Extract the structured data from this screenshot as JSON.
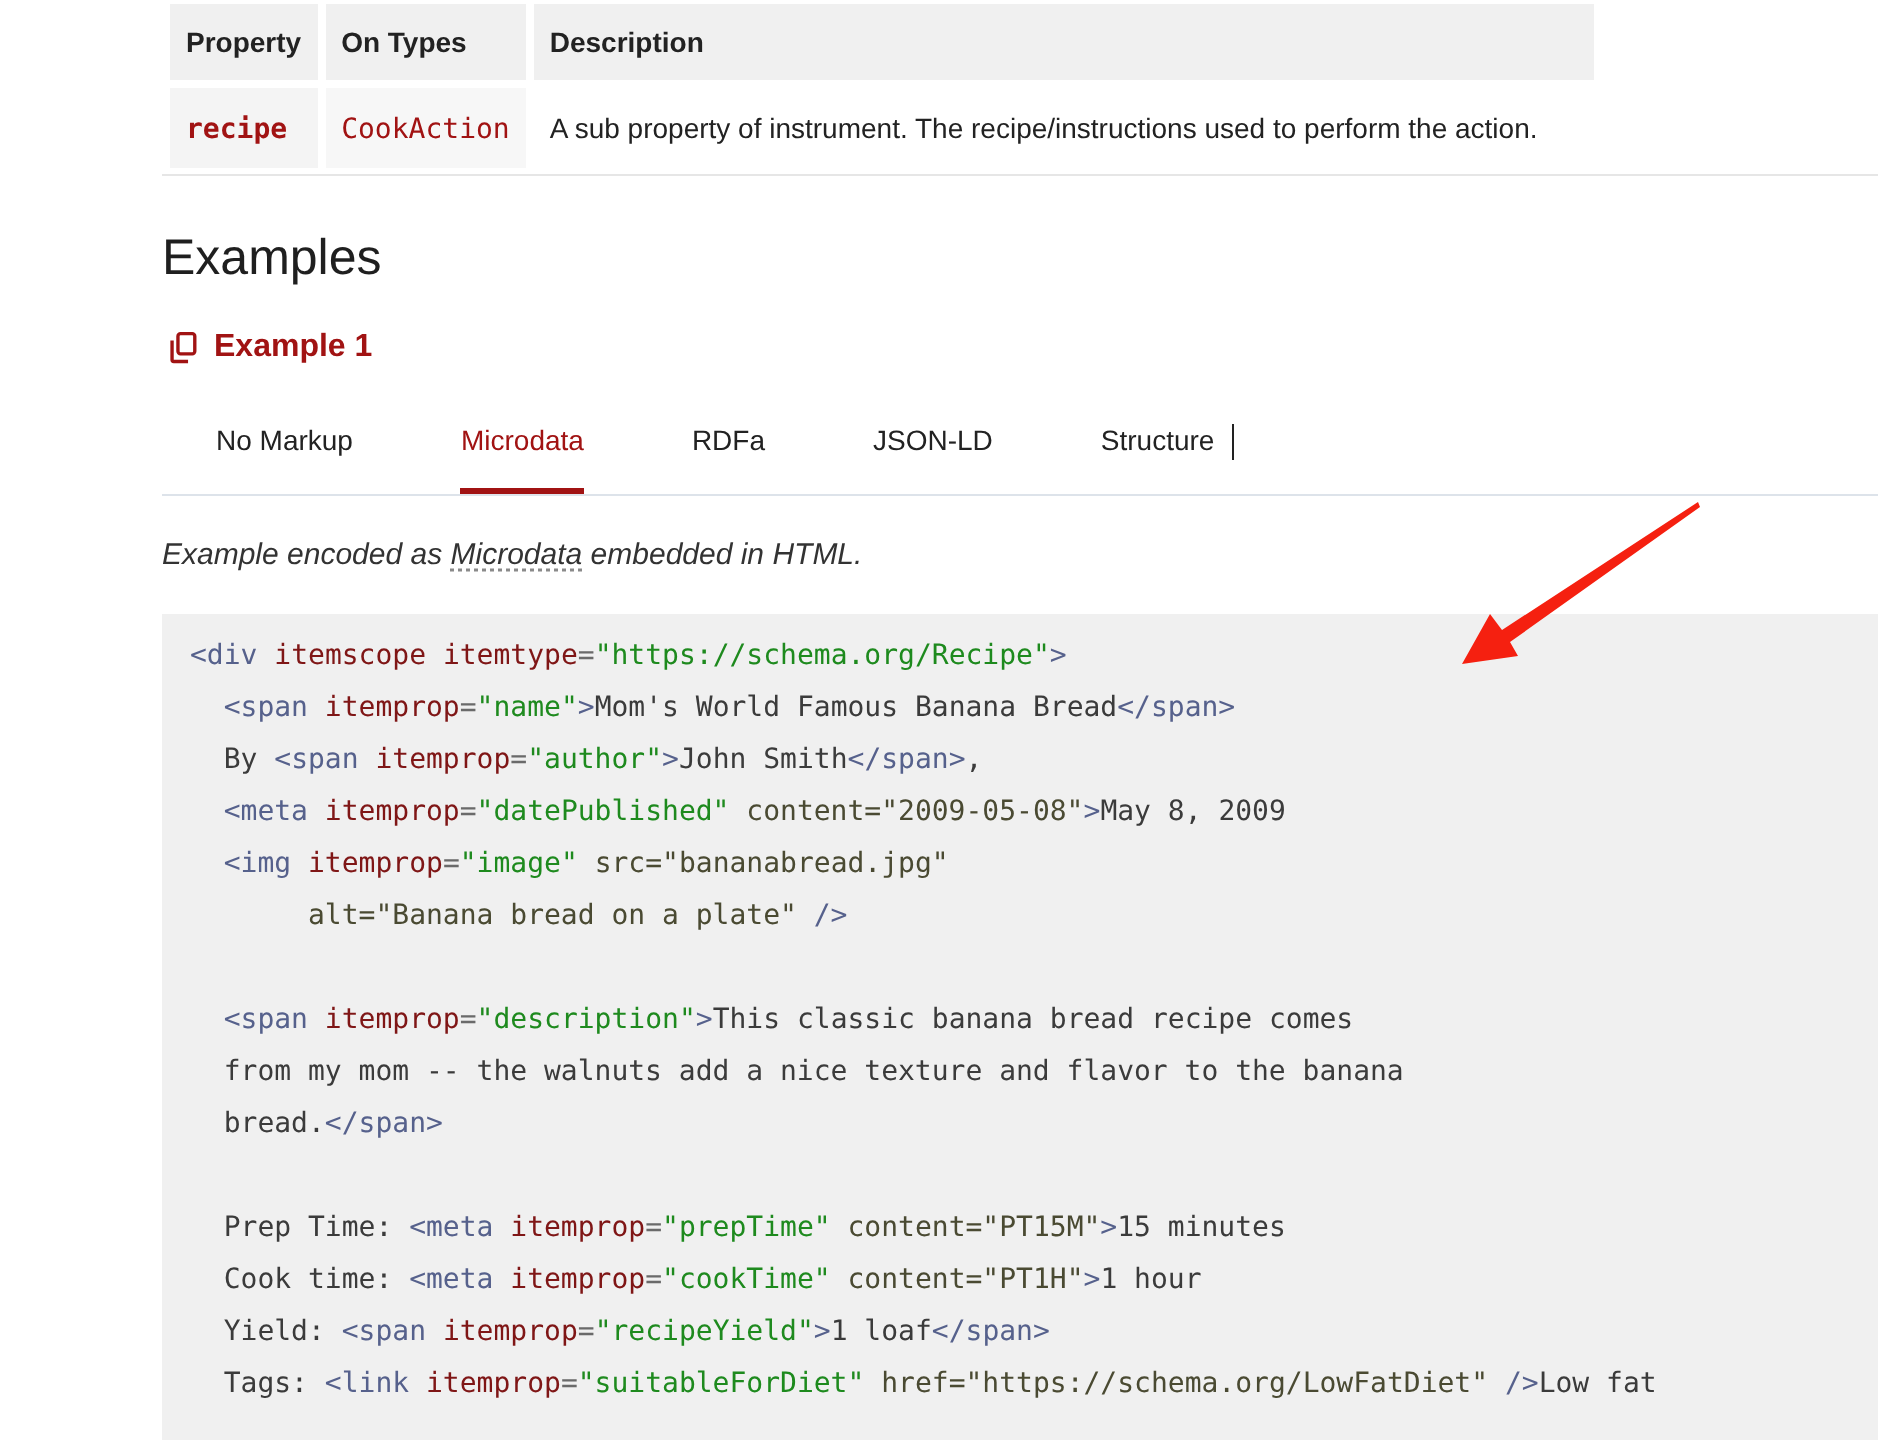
{
  "table": {
    "columns": [
      "Property",
      "On Types",
      "Description"
    ],
    "rows": [
      {
        "cells": [
          {
            "kind": "property",
            "text": "recipe"
          },
          {
            "kind": "type",
            "text": "CookAction"
          },
          {
            "kind": "description",
            "text": "A sub property of instrument. The recipe/instructions used to perform the action."
          }
        ]
      }
    ]
  },
  "section_title": "Examples",
  "example": {
    "title": "Example 1"
  },
  "tabs": [
    {
      "label": "No Markup",
      "selected": false
    },
    {
      "label": "Microdata",
      "selected": true
    },
    {
      "label": "RDFa",
      "selected": false
    },
    {
      "label": "JSON-LD",
      "selected": false
    },
    {
      "label": "Structure",
      "selected": false
    }
  ],
  "intro": {
    "before": "Example encoded as ",
    "link": "Microdata",
    "after": " embedded in HTML."
  },
  "code": {
    "lines": [
      {
        "kind": "code",
        "tokens": [
          {
            "kind": "tag",
            "text": "<div "
          },
          {
            "kind": "attr",
            "text": "itemscope itemtype"
          },
          {
            "kind": "op",
            "text": "="
          },
          {
            "kind": "val",
            "text": "\"https://schema.org/Recipe\""
          },
          {
            "kind": "tag",
            "text": ">"
          }
        ]
      },
      {
        "kind": "code",
        "tokens": [
          {
            "kind": "tag",
            "text": "  <span "
          },
          {
            "kind": "attr",
            "text": "itemprop"
          },
          {
            "kind": "op",
            "text": "="
          },
          {
            "kind": "val",
            "text": "\"name\""
          },
          {
            "kind": "tag",
            "text": ">"
          },
          {
            "kind": "text",
            "text": "Mom's World Famous Banana Bread"
          },
          {
            "kind": "tag",
            "text": "</span>"
          }
        ]
      },
      {
        "kind": "code",
        "tokens": [
          {
            "kind": "text",
            "text": "  By "
          },
          {
            "kind": "tag",
            "text": "<span "
          },
          {
            "kind": "attr",
            "text": "itemprop"
          },
          {
            "kind": "op",
            "text": "="
          },
          {
            "kind": "val",
            "text": "\"author\""
          },
          {
            "kind": "tag",
            "text": ">"
          },
          {
            "kind": "text",
            "text": "John Smith"
          },
          {
            "kind": "tag",
            "text": "</span>"
          },
          {
            "kind": "text",
            "text": ","
          }
        ]
      },
      {
        "kind": "code",
        "tokens": [
          {
            "kind": "tag",
            "text": "  <meta "
          },
          {
            "kind": "attr",
            "text": "itemprop"
          },
          {
            "kind": "op",
            "text": "="
          },
          {
            "kind": "val",
            "text": "\"datePublished\""
          },
          {
            "kind": "other",
            "text": " content=\"2009-05-08\""
          },
          {
            "kind": "tag",
            "text": ">"
          },
          {
            "kind": "text",
            "text": "May 8, 2009"
          }
        ]
      },
      {
        "kind": "code",
        "tokens": [
          {
            "kind": "tag",
            "text": "  <img "
          },
          {
            "kind": "attr",
            "text": "itemprop"
          },
          {
            "kind": "op",
            "text": "="
          },
          {
            "kind": "val",
            "text": "\"image\""
          },
          {
            "kind": "other",
            "text": " src=\"bananabread.jpg\""
          }
        ]
      },
      {
        "kind": "code",
        "tokens": [
          {
            "kind": "other",
            "text": "       alt=\"Banana bread on a plate\" "
          },
          {
            "kind": "tag",
            "text": "/>"
          }
        ]
      },
      {
        "kind": "blank"
      },
      {
        "kind": "code",
        "tokens": [
          {
            "kind": "tag",
            "text": "  <span "
          },
          {
            "kind": "attr",
            "text": "itemprop"
          },
          {
            "kind": "op",
            "text": "="
          },
          {
            "kind": "val",
            "text": "\"description\""
          },
          {
            "kind": "tag",
            "text": ">"
          },
          {
            "kind": "text",
            "text": "This classic banana bread recipe comes"
          }
        ]
      },
      {
        "kind": "code",
        "tokens": [
          {
            "kind": "text",
            "text": "  from my mom -- the walnuts add a nice texture and flavor to the banana"
          }
        ]
      },
      {
        "kind": "code",
        "tokens": [
          {
            "kind": "text",
            "text": "  bread."
          },
          {
            "kind": "tag",
            "text": "</span>"
          }
        ]
      },
      {
        "kind": "blank"
      },
      {
        "kind": "code",
        "tokens": [
          {
            "kind": "text",
            "text": "  Prep Time: "
          },
          {
            "kind": "tag",
            "text": "<meta "
          },
          {
            "kind": "attr",
            "text": "itemprop"
          },
          {
            "kind": "op",
            "text": "="
          },
          {
            "kind": "val",
            "text": "\"prepTime\""
          },
          {
            "kind": "other",
            "text": " content=\"PT15M\""
          },
          {
            "kind": "tag",
            "text": ">"
          },
          {
            "kind": "text",
            "text": "15 minutes"
          }
        ]
      },
      {
        "kind": "code",
        "tokens": [
          {
            "kind": "text",
            "text": "  Cook time: "
          },
          {
            "kind": "tag",
            "text": "<meta "
          },
          {
            "kind": "attr",
            "text": "itemprop"
          },
          {
            "kind": "op",
            "text": "="
          },
          {
            "kind": "val",
            "text": "\"cookTime\""
          },
          {
            "kind": "other",
            "text": " content=\"PT1H\""
          },
          {
            "kind": "tag",
            "text": ">"
          },
          {
            "kind": "text",
            "text": "1 hour"
          }
        ]
      },
      {
        "kind": "code",
        "tokens": [
          {
            "kind": "text",
            "text": "  Yield: "
          },
          {
            "kind": "tag",
            "text": "<span "
          },
          {
            "kind": "attr",
            "text": "itemprop"
          },
          {
            "kind": "op",
            "text": "="
          },
          {
            "kind": "val",
            "text": "\"recipeYield\""
          },
          {
            "kind": "tag",
            "text": ">"
          },
          {
            "kind": "text",
            "text": "1 loaf"
          },
          {
            "kind": "tag",
            "text": "</span>"
          }
        ]
      },
      {
        "kind": "code",
        "tokens": [
          {
            "kind": "text",
            "text": "  Tags: "
          },
          {
            "kind": "tag",
            "text": "<link "
          },
          {
            "kind": "attr",
            "text": "itemprop"
          },
          {
            "kind": "op",
            "text": "="
          },
          {
            "kind": "val",
            "text": "\"suitableForDiet\""
          },
          {
            "kind": "other",
            "text": " href=\"https://schema.org/LowFatDiet\" "
          },
          {
            "kind": "tag",
            "text": "/>"
          },
          {
            "kind": "text",
            "text": "Low fat"
          }
        ]
      }
    ]
  }
}
